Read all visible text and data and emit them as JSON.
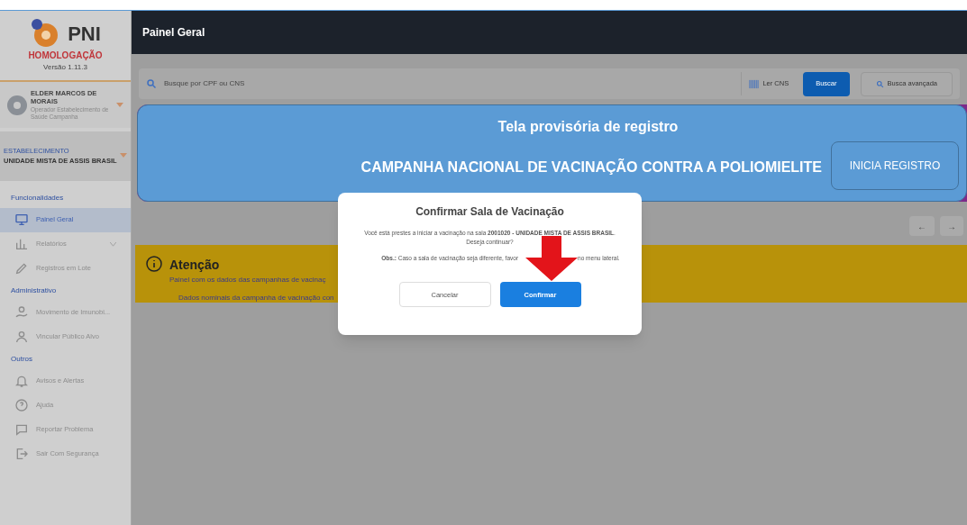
{
  "sidebar": {
    "logo": "PNI",
    "environment": "HOMOLOGAÇÃO",
    "version": "Versão 1.11.3",
    "user": {
      "name": "ELDER MARCOS DE MORAIS",
      "role": "Operador Estabelecimento de Saúde Campanha"
    },
    "establishment": {
      "label": "ESTABELECIMENTO",
      "value": "UNIDADE MISTA DE ASSIS BRASIL"
    },
    "sections": [
      {
        "title": "Funcionalidades",
        "items": [
          {
            "label": "Painel Geral",
            "kind": "panel",
            "selected": true,
            "expandable": false
          },
          {
            "label": "Relatórios",
            "kind": "chart",
            "selected": false,
            "expandable": true
          },
          {
            "label": "Registros em Lote",
            "kind": "pen",
            "selected": false,
            "expandable": false
          }
        ]
      },
      {
        "title": "Administrativo",
        "items": [
          {
            "label": "Movimento de Imunobi...",
            "kind": "hand",
            "selected": false,
            "expandable": false
          },
          {
            "label": "Vincular Público Alvo",
            "kind": "user",
            "selected": false,
            "expandable": false
          }
        ]
      },
      {
        "title": "Outros",
        "items": [
          {
            "label": "Avisos e Alertas",
            "kind": "bell",
            "selected": false,
            "expandable": false
          },
          {
            "label": "Ajuda",
            "kind": "help",
            "selected": false,
            "expandable": false
          },
          {
            "label": "Reportar Problema",
            "kind": "chat",
            "selected": false,
            "expandable": false
          },
          {
            "label": "Sair Com Segurança",
            "kind": "exit",
            "selected": false,
            "expandable": false
          }
        ]
      }
    ]
  },
  "header": {
    "title": "Painel Geral"
  },
  "search": {
    "placeholder": "Busque por CPF ou CNS",
    "read_button": "Ler CNS",
    "search_button": "Buscar",
    "advanced_button": "Busca avançada"
  },
  "banner": {
    "title": "Tela provisória de registro",
    "campaign": "CAMPANHA NACIONAL DE VACINAÇÃO CONTRA A POLIOMIELITE",
    "button": "INICIA REGISTRO"
  },
  "pager": {
    "prev": "←",
    "next": "→"
  },
  "notice": {
    "title": "Atenção",
    "lines": [
      "Painel com os dados das campanhas de vacinaç",
      "Dados nominais da campanha de vacinação con"
    ]
  },
  "dialog": {
    "title": "Confirmar Sala de Vacinação",
    "message": "Você está prestes a iniciar a vacinação na sala **2001020 - UNIDADE MISTA DE ASSIS BRASIL**. Deseja continuar?",
    "note": "**Obs.:** Caso a sala de vacinação seja diferente, favor",
    "note_end": "no menu lateral.",
    "cancel": "Cancelar",
    "confirm": "Confirmar"
  }
}
